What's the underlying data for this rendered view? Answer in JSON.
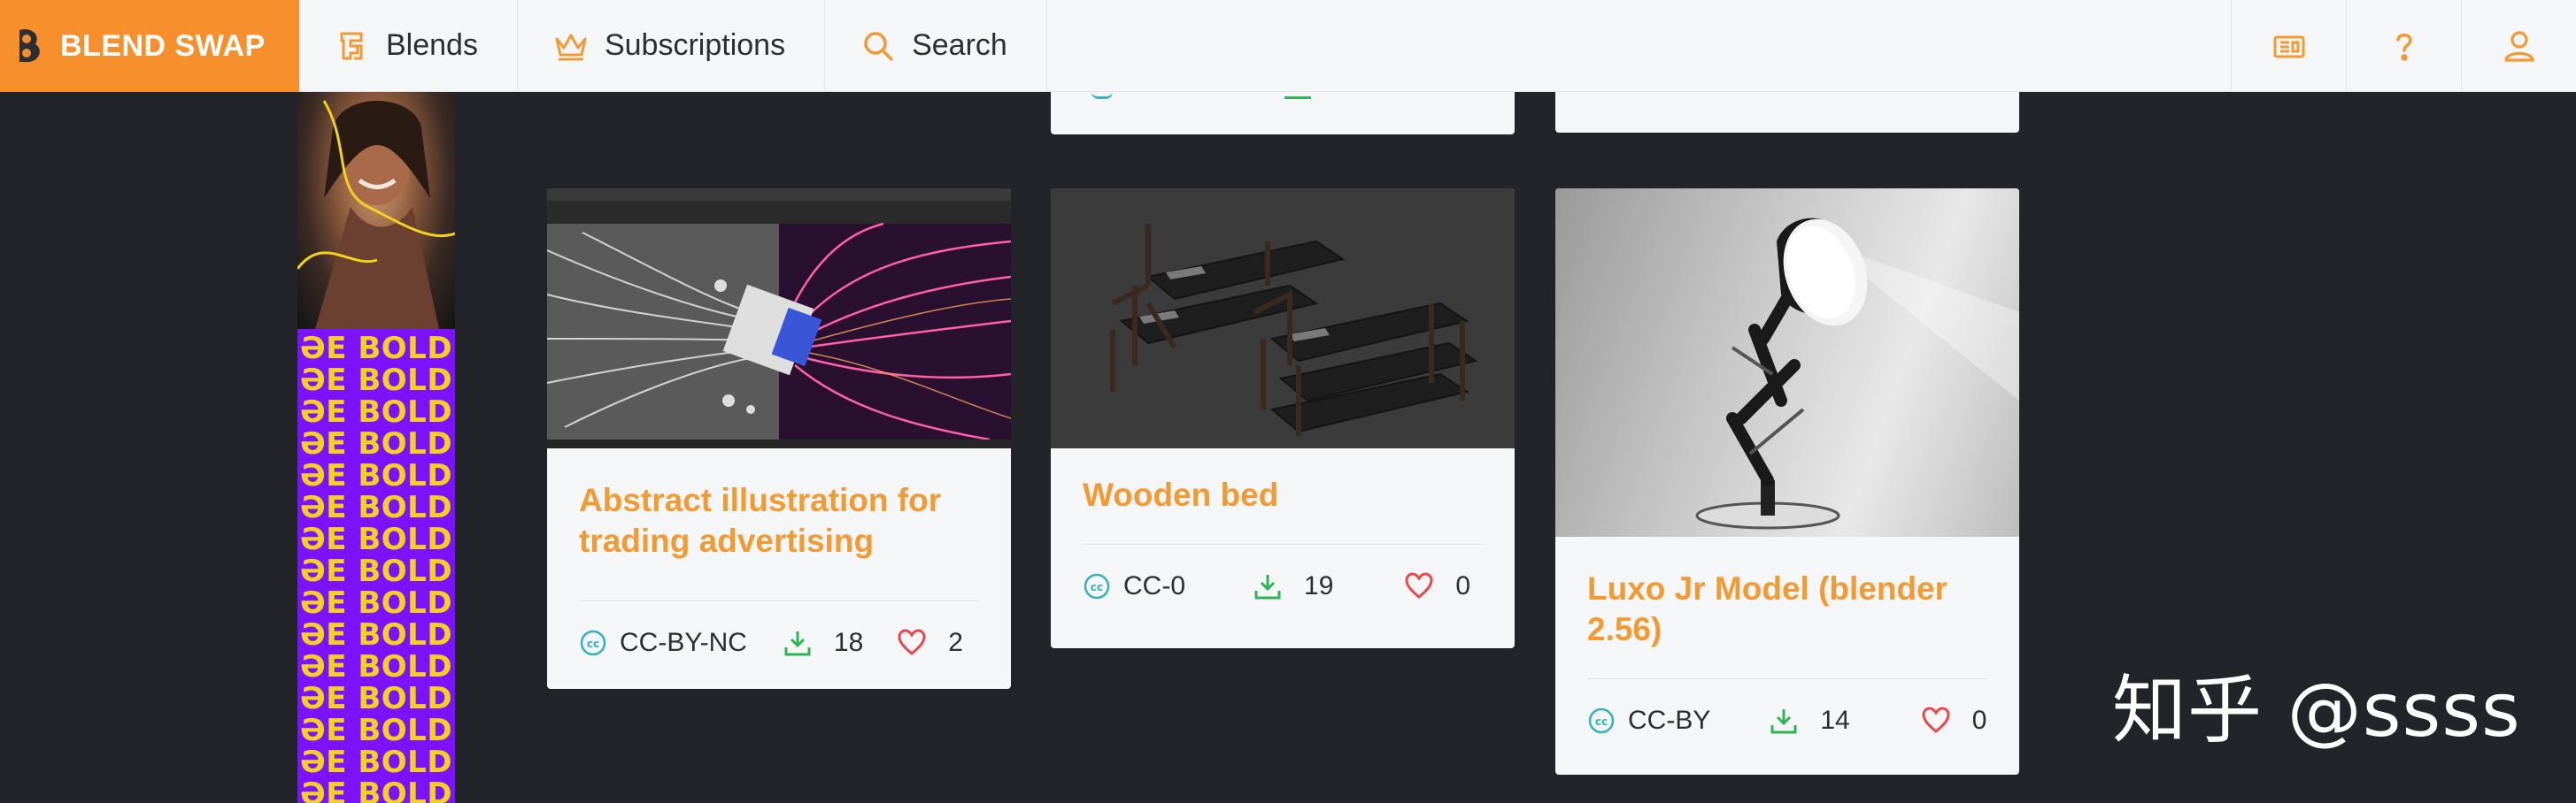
{
  "brand": {
    "name": "BLEND SWAP",
    "color": "#f7902c"
  },
  "nav": {
    "items": [
      {
        "label": "Blends",
        "icon": "blends-icon"
      },
      {
        "label": "Subscriptions",
        "icon": "crown-icon"
      },
      {
        "label": "Search",
        "icon": "search-icon"
      }
    ],
    "right_icons": [
      "newspaper-icon",
      "help-icon",
      "user-icon"
    ]
  },
  "ad": {
    "bold_lines": [
      "ƏE BOLD",
      "ƏE BOLD",
      "ƏE BOLD",
      "ƏE BOLD",
      "ƏE BOLD",
      "ƏE BOLD",
      "ƏE BOLD",
      "ƏE BOLD",
      "ƏE BOLD",
      "ƏE BOLD",
      "ƏE BOLD",
      "ƏE BOLD",
      "ƏE BOLD",
      "ƏE BOLD",
      "ƏE BOLD"
    ],
    "bg_color": "#7c12ff",
    "text_color": "#f3d21b"
  },
  "cards": [
    {
      "title_line1": "Abstract illustration for",
      "title_line2": "trading advertising",
      "license": "CC-BY-NC",
      "downloads": "18",
      "likes": "2",
      "thumb": "abstract-render"
    },
    {
      "title_line1": "Wooden bed",
      "title_line2": "",
      "license": "CC-0",
      "downloads": "19",
      "likes": "0",
      "thumb": "wooden-beds"
    },
    {
      "title_line1": "Luxo Jr Model (blender",
      "title_line2": "2.56)",
      "license": "CC-BY",
      "downloads": "14",
      "likes": "0",
      "thumb": "luxo-lamp"
    }
  ],
  "colors": {
    "accent": "#f29a34",
    "license": "#36b3b8",
    "download": "#2fb558",
    "like": "#e8474c"
  },
  "watermark": "知乎 @ssss"
}
